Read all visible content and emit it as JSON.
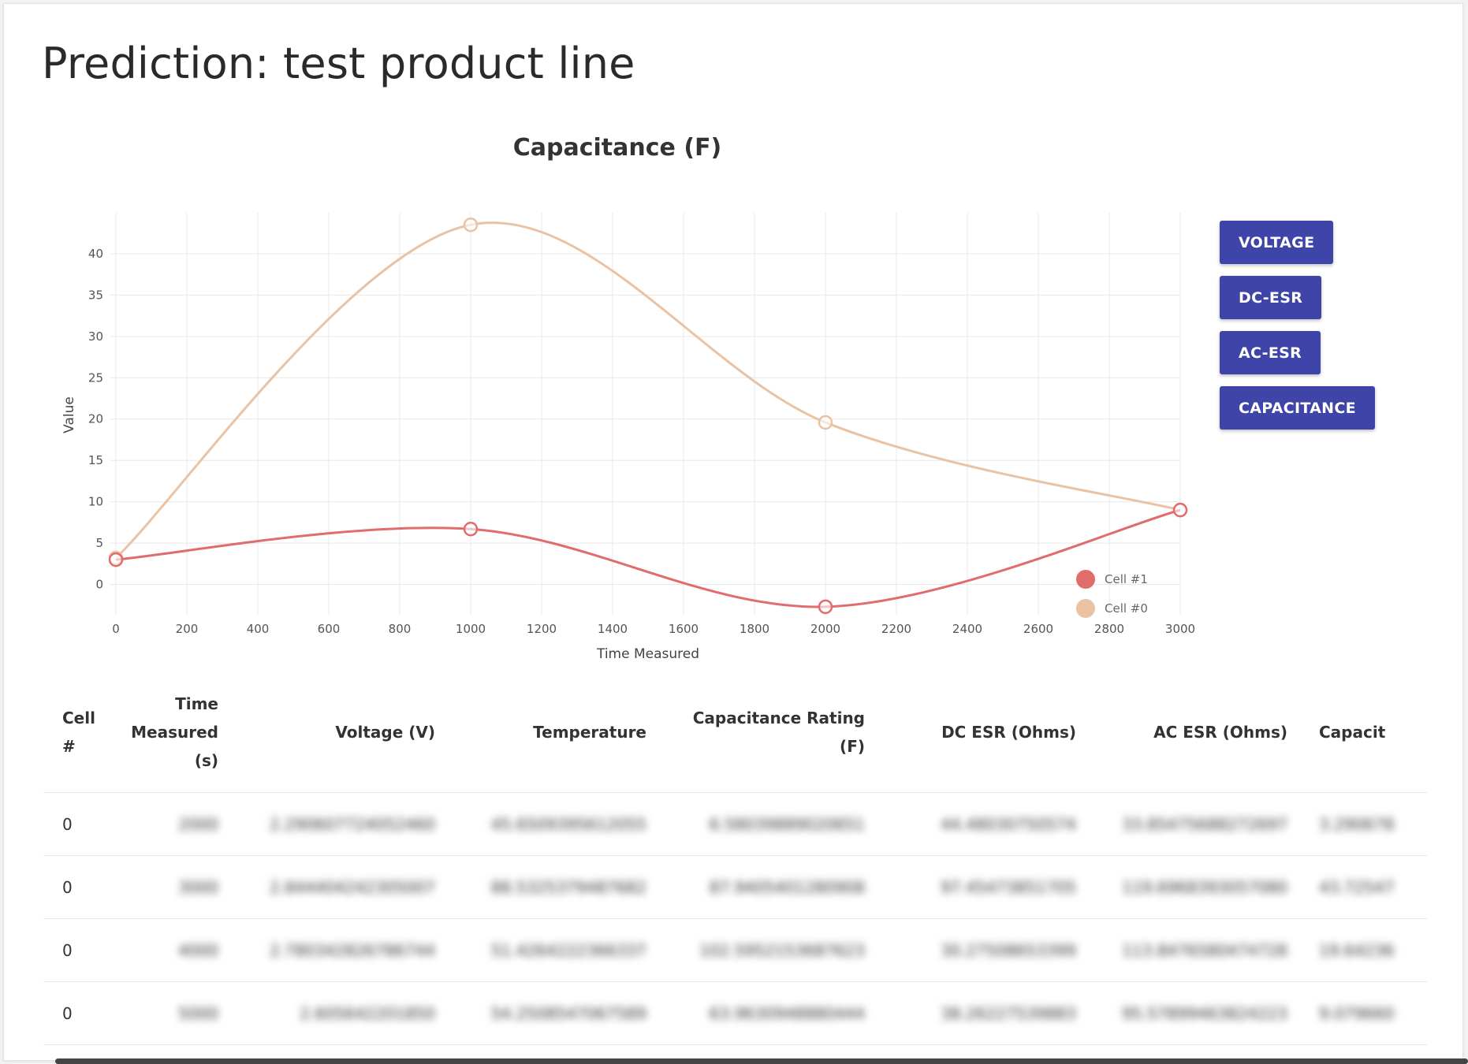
{
  "page": {
    "title": "Prediction: test product line"
  },
  "chart": {
    "title": "Capacitance (F)",
    "buttons": [
      "VOLTAGE",
      "DC-ESR",
      "AC-ESR",
      "CAPACITANCE"
    ]
  },
  "chart_data": {
    "type": "line",
    "title": "Capacitance (F)",
    "xlabel": "Time Measured",
    "ylabel": "Value",
    "xlim": [
      0,
      3000
    ],
    "ylim": [
      -3,
      44
    ],
    "xticks": [
      0,
      200,
      400,
      600,
      800,
      1000,
      1200,
      1400,
      1600,
      1800,
      2000,
      2200,
      2400,
      2600,
      2800,
      3000
    ],
    "yticks": [
      0,
      5,
      10,
      15,
      20,
      25,
      30,
      35,
      40
    ],
    "grid": true,
    "legend_position": "bottom-right",
    "series": [
      {
        "name": "Cell #1",
        "color": "#e06c6c",
        "x": [
          0,
          1000,
          2000,
          3000
        ],
        "y": [
          3,
          6.7,
          -2.7,
          9
        ]
      },
      {
        "name": "Cell #0",
        "color": "#e9c3a3",
        "x": [
          0,
          1000,
          2000,
          3000
        ],
        "y": [
          3.2,
          43.5,
          19.6,
          9
        ]
      }
    ]
  },
  "table": {
    "headers": [
      "Cell #",
      "Time Measured (s)",
      "Voltage (V)",
      "Temperature",
      "Capacitance Rating (F)",
      "DC ESR (Ohms)",
      "AC ESR (Ohms)",
      "Capacit"
    ],
    "rows": [
      [
        "0",
        "2000",
        "2.290607724052460",
        "45.6509395612055",
        "6.58039889020651",
        "44.48030750574",
        "33.85475688272697",
        "3.290678"
      ],
      [
        "0",
        "3000",
        "2.844404242305007",
        "88.5325379487682",
        "87.9405401280908",
        "97.45473851705",
        "119.6968393057080",
        "43.72547"
      ],
      [
        "0",
        "4000",
        "2.780342826786744",
        "51.4264222366337",
        "102.5952153687623",
        "30.27508653399",
        "113.8476580474728",
        "19.64236"
      ],
      [
        "0",
        "5000",
        "2.605642201850",
        "54.2508547067589",
        "63.9630948880444",
        "38.26227539883",
        "95.57899463824223",
        "9.079660"
      ]
    ]
  }
}
